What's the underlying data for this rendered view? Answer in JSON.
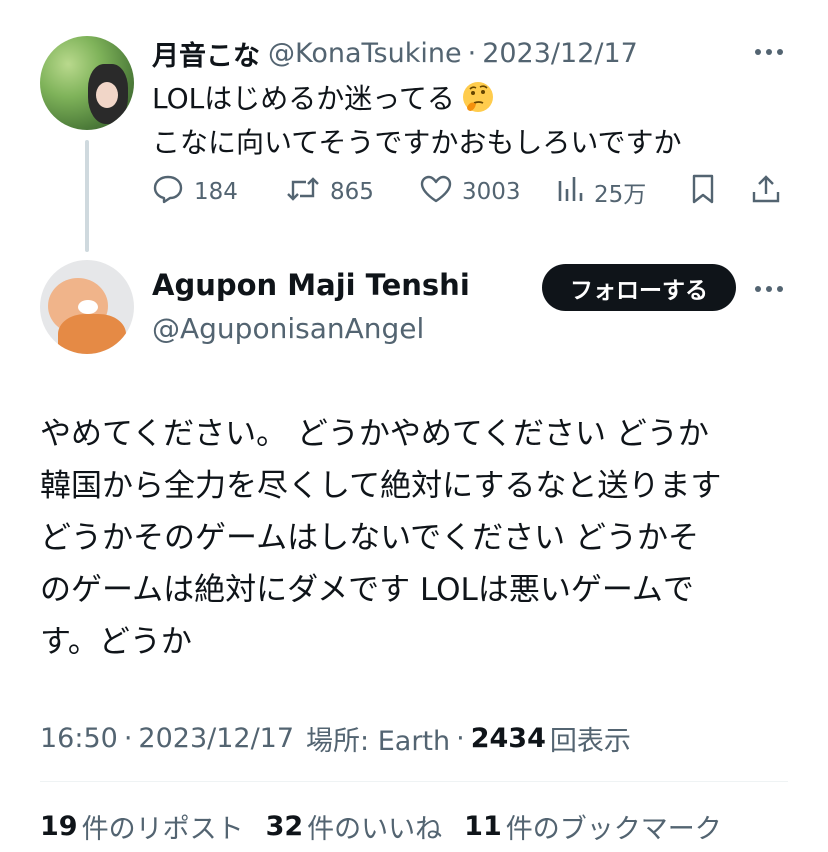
{
  "parent_tweet": {
    "display_name": "月音こな",
    "handle": "@KonaTsukine",
    "separator": "·",
    "date": "2023/12/17",
    "text_line1": "LOLはじめるか迷ってる",
    "text_line2": "こなに向いてそうですかおもしろいですか",
    "emoji": "thinking-face",
    "actions": {
      "reply_count": "184",
      "repost_count": "865",
      "like_count": "3003",
      "view_count": "25万"
    }
  },
  "main_tweet": {
    "display_name": "Agupon Maji Tenshi",
    "handle": "@AguponisanAngel",
    "follow_label": "フォローする",
    "text_lines": [
      "やめてください。 どうかやめてください どうか",
      "韓国から全力を尽くして絶対にするなと送ります",
      "どうかそのゲームはしないでください どうかそ",
      "のゲームは絶対にダメです LOLは悪いゲームで",
      "す。どうか"
    ],
    "meta": {
      "time": "16:50",
      "separator": "·",
      "date": "2023/12/17",
      "location": "場所: Earth",
      "views_count": "2434",
      "views_label": "回表示"
    },
    "stats": {
      "reposts_count": "19",
      "reposts_label": "件のリポスト",
      "likes_count": "32",
      "likes_label": "件のいいね",
      "bookmarks_count": "11",
      "bookmarks_label": "件のブックマーク"
    }
  },
  "colors": {
    "text": "#0f1419",
    "muted": "#536471",
    "thread_line": "#cfd9de",
    "button_bg": "#0f1419",
    "divider": "#eff3f4"
  }
}
